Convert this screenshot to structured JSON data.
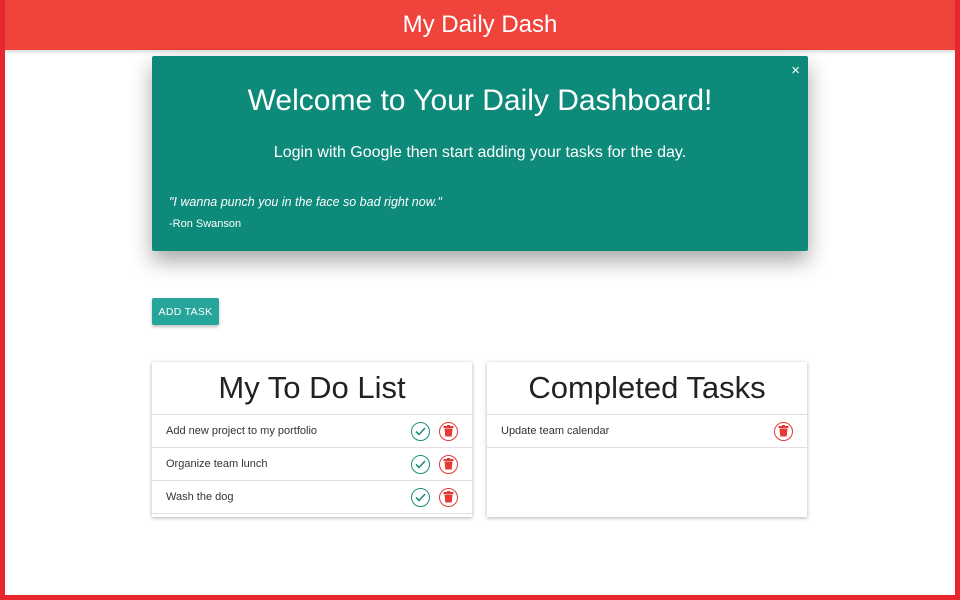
{
  "header": {
    "title": "My Daily Dash"
  },
  "welcome": {
    "title": "Welcome to Your Daily Dashboard!",
    "subtitle": "Login with Google then start adding your tasks for the day.",
    "quote": "\"I wanna punch you in the face so bad right now.\"",
    "author": "-Ron Swanson",
    "close_label": "×"
  },
  "add_task_label": "ADD TASK",
  "todo": {
    "title": "My To Do List",
    "items": [
      {
        "text": "Add new project to my portfolio"
      },
      {
        "text": "Organize team lunch"
      },
      {
        "text": "Wash the dog"
      }
    ]
  },
  "completed": {
    "title": "Completed Tasks",
    "items": [
      {
        "text": "Update team calendar"
      }
    ]
  },
  "colors": {
    "header": "#f0433b",
    "welcome_bg": "#0e8a7a",
    "button": "#26a69a",
    "check": "#1b8f7d",
    "trash": "#e53935"
  },
  "icons": {
    "check": "check-circle-icon",
    "trash": "trash-icon"
  }
}
